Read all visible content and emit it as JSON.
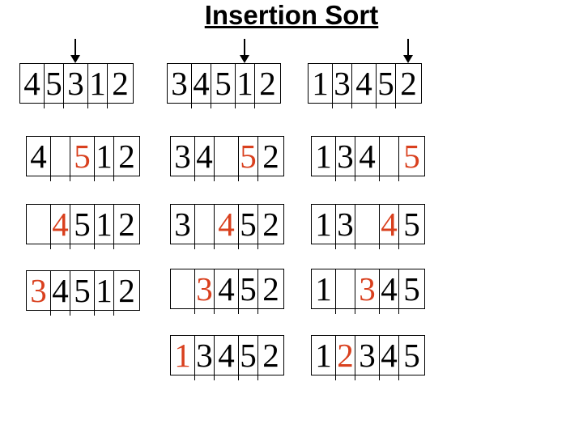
{
  "title": "Insertion Sort",
  "colors": {
    "highlight": "#d9401e",
    "normal": "#000000"
  },
  "columns": [
    {
      "pointer_index": 2,
      "rows": [
        {
          "cells": [
            "4",
            "5",
            "3",
            "1",
            "2"
          ],
          "highlight": -1
        },
        {
          "cells": [
            "4",
            "",
            "5",
            "1",
            "2"
          ],
          "highlight": 2
        },
        {
          "cells": [
            "",
            "4",
            "5",
            "1",
            "2"
          ],
          "highlight": 1
        },
        {
          "cells": [
            "3",
            "4",
            "5",
            "1",
            "2"
          ],
          "highlight": 0
        }
      ]
    },
    {
      "pointer_index": 3,
      "rows": [
        {
          "cells": [
            "3",
            "4",
            "5",
            "1",
            "2"
          ],
          "highlight": -1
        },
        {
          "cells": [
            "3",
            "4",
            "",
            "5",
            "2"
          ],
          "highlight": 3
        },
        {
          "cells": [
            "3",
            "",
            "4",
            "5",
            "2"
          ],
          "highlight": 2
        },
        {
          "cells": [
            "",
            "3",
            "4",
            "5",
            "2"
          ],
          "highlight": 1
        },
        {
          "cells": [
            "1",
            "3",
            "4",
            "5",
            "2"
          ],
          "highlight": 0
        }
      ]
    },
    {
      "pointer_index": 4,
      "rows": [
        {
          "cells": [
            "1",
            "3",
            "4",
            "5",
            "2"
          ],
          "highlight": -1
        },
        {
          "cells": [
            "1",
            "3",
            "4",
            "",
            "5"
          ],
          "highlight": 4
        },
        {
          "cells": [
            "1",
            "3",
            "",
            "4",
            "5"
          ],
          "highlight": 3
        },
        {
          "cells": [
            "1",
            "",
            "3",
            "4",
            "5"
          ],
          "highlight": 2
        },
        {
          "cells": [
            "1",
            "2",
            "3",
            "4",
            "5"
          ],
          "highlight": 1
        }
      ]
    }
  ]
}
